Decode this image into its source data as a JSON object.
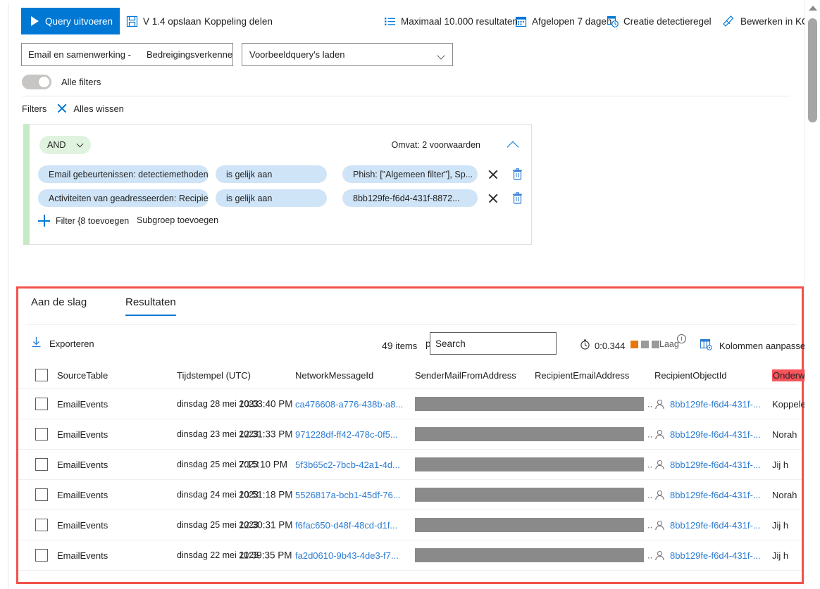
{
  "toolbar": {
    "run_query": "Query uitvoeren",
    "save": "V 1.4 opslaan",
    "share_link": "Koppeling delen",
    "max_results": "Maximaal 10.000 resultaten",
    "time_range": "Afgelopen 7 dagen",
    "create_rule": "Creatie detectieregel",
    "edit_kql": "Bewerken in KQL"
  },
  "scope": {
    "left": "Email en samenwerking -",
    "right": "Bedreigingsverkenner",
    "sample_query": "Voorbeeldquery's laden"
  },
  "filters_toggle": {
    "label": "Alle filters",
    "state": "off"
  },
  "filters_header": {
    "label": "Filters",
    "clear_all": "Alles wissen"
  },
  "filter_group": {
    "operator": "AND",
    "summary": "Omvat: 2 voorwaarden",
    "rows": [
      {
        "field": "Email gebeurtenissen: detectiemethoden",
        "operator": "is gelijk aan",
        "value": "Phish: [\"Algemeen filter\"], Sp..."
      },
      {
        "field": "Activiteiten van geadresseerden: RecipientObj...",
        "operator": "is gelijk aan",
        "value": "8bb129fe-f6d4-431f-8872..."
      }
    ],
    "add_filter": "Filter {8 toevoegen",
    "add_subgroup": "Subgroep toevoegen"
  },
  "results": {
    "tabs": [
      {
        "label": "Aan de slag",
        "active": false
      },
      {
        "label": "Resultaten",
        "active": true
      }
    ],
    "export": "Exporteren",
    "item_count": "49",
    "items_word": "items",
    "search_prefix": "p",
    "search_value": "Search",
    "search_placeholder": "Search",
    "duration": "0:0.344",
    "severity_label": "Laag",
    "severity_filled": 1,
    "severity_total": 3,
    "info_glyph": "i",
    "customize_columns": "Kolommen aanpassen",
    "columns": [
      "SourceTable",
      "Tijdstempel (UTC)",
      "NetworkMessageId",
      "SenderMailFromAddress",
      "RecipientEmailAddress",
      "RecipientObjectId",
      "Onderwerp"
    ],
    "redacted_dots": "..",
    "rows": [
      {
        "source_table": "EmailEvents",
        "date": "dinsdag 28 mei 2023",
        "time": "10:03:40 PM",
        "network_message_id": "ca476608-a776-438b-a8...",
        "recipient_object_id": "8bb129fe-f6d4-431f-...",
        "subject": "Koppelen",
        "subject_extra": ""
      },
      {
        "source_table": "EmailEvents",
        "date": "dinsdag 23 mei 2023",
        "time": "12:31:33 PM",
        "network_message_id": "971228df-ff42-478c-0f5...",
        "recipient_object_id": "8bb129fe-f6d4-431f-...",
        "subject": "Norah",
        "subject_extra": ""
      },
      {
        "source_table": "EmailEvents",
        "date": "dinsdag 25 mei 2023",
        "time": "7:15:10 PM",
        "network_message_id": "5f3b65c2-7bcb-42a1-4d...",
        "recipient_object_id": "8bb129fe-f6d4-431f-...",
        "subject": "Jij h",
        "subject_extra": "a"
      },
      {
        "source_table": "EmailEvents",
        "date": "dinsdag 24 mei 2023",
        "time": "10:51:18 PM",
        "network_message_id": "5526817a-bcb1-45df-76...",
        "recipient_object_id": "8bb129fe-f6d4-431f-...",
        "subject": "Norah",
        "subject_extra": ""
      },
      {
        "source_table": "EmailEvents",
        "date": "dinsdag 25 mei 2023",
        "time": "12:30:31 PM",
        "network_message_id": "f6fac650-d48f-48cd-d1f...",
        "recipient_object_id": "8bb129fe-f6d4-431f-...",
        "subject": "Jij h",
        "subject_extra": "a"
      },
      {
        "source_table": "EmailEvents",
        "date": "dinsdag 22 mei 2023",
        "time": "11:39:35 PM",
        "network_message_id": "fa2d0610-9b43-4de3-f7...",
        "recipient_object_id": "8bb129fe-f6d4-431f-...",
        "subject": "Jij h",
        "subject_extra": "a"
      }
    ]
  },
  "colors": {
    "accent": "#0078d4",
    "annotation": "#f3524a",
    "chip": "#cfe4f7",
    "and_pill": "#dff3df",
    "severity_on": "#e8760c",
    "severity_off": "#9a9a9a",
    "link": "#2b7cd3",
    "redaction": "#8a8a8a",
    "subject_highlight": "#f7545c"
  }
}
